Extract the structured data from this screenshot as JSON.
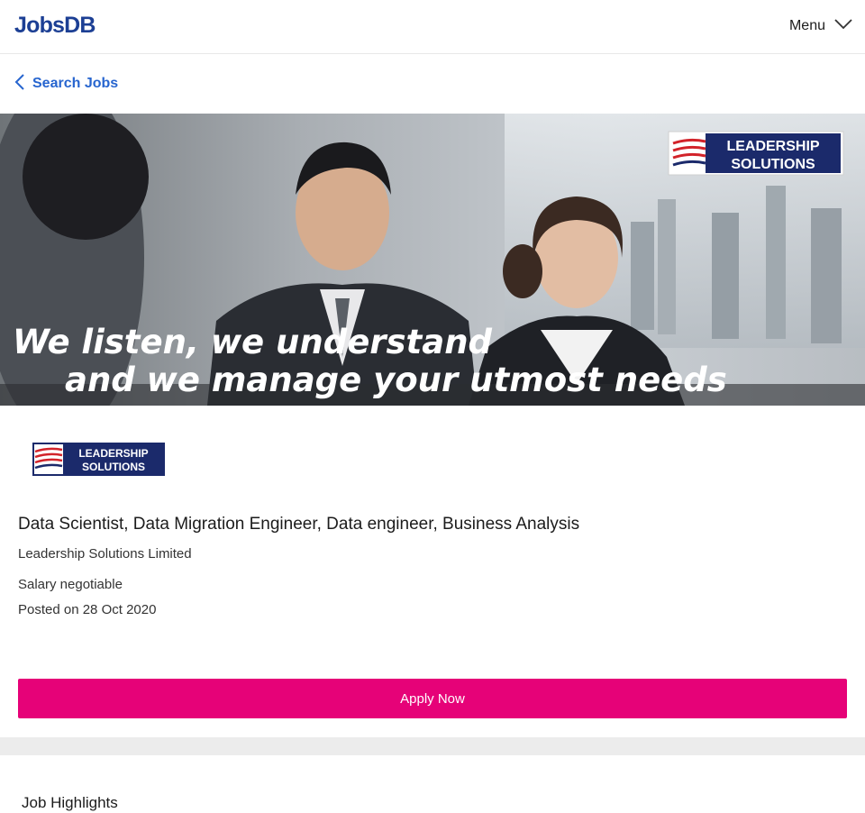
{
  "header": {
    "logo_text": "JobsDB",
    "menu_label": "Menu",
    "menu_icon": "chevron-down-icon"
  },
  "nav": {
    "back_label": "Search Jobs",
    "back_icon": "chevron-left-icon"
  },
  "banner": {
    "brand_line1": "LEADERSHIP",
    "brand_line2": "SOLUTIONS",
    "tagline_line1": "We listen, we understand",
    "tagline_line2": "and we manage your utmost needs"
  },
  "company_logo": {
    "line1": "LEADERSHIP",
    "line2": "SOLUTIONS"
  },
  "job": {
    "title": "Data Scientist, Data Migration Engineer, Data engineer, Business Analysis",
    "company": "Leadership Solutions Limited",
    "salary": "Salary negotiable",
    "posted": "Posted on 28 Oct 2020",
    "apply_label": "Apply Now"
  },
  "highlights": {
    "title": "Job Highlights"
  },
  "colors": {
    "brand": "#1c3f94",
    "link": "#2765cf",
    "apply": "#e60278",
    "logo_navy": "#1b2a6b",
    "logo_red": "#d2232a"
  }
}
